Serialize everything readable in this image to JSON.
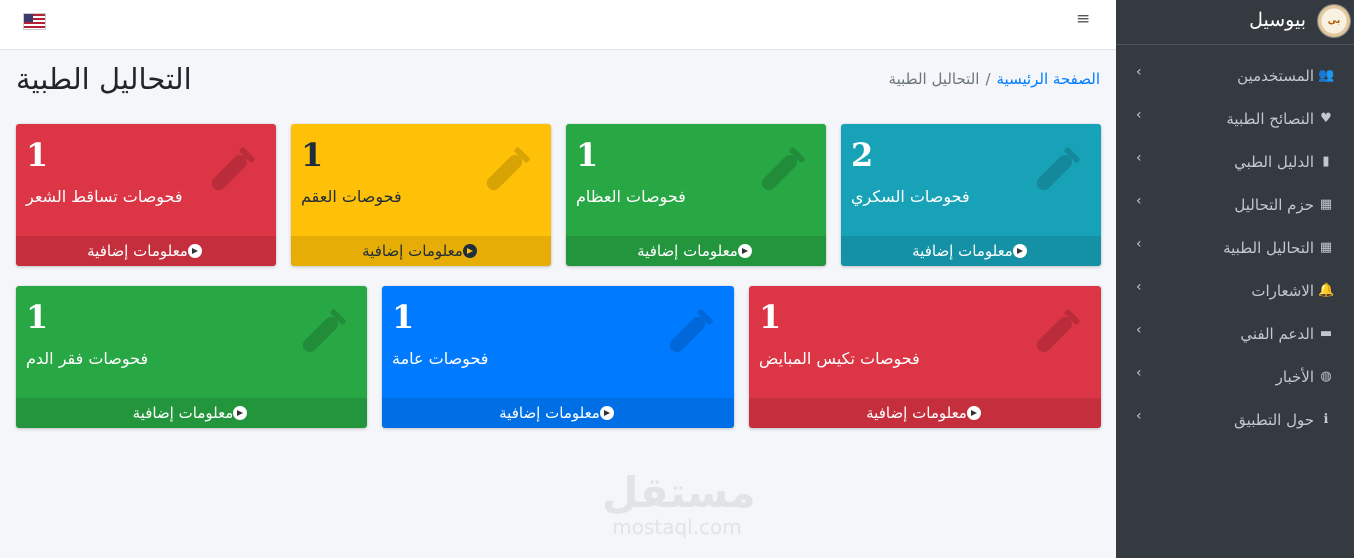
{
  "navbar": {
    "menu_icon": "bars-icon",
    "flag": "us-flag-icon"
  },
  "brand": {
    "name": "بيوسيل",
    "logo_text": "بي"
  },
  "sidebar": {
    "items": [
      {
        "label": "المستخدمين",
        "icon": "users-icon",
        "glyph": "👥"
      },
      {
        "label": "النصائح الطبية",
        "icon": "heartbeat-icon",
        "glyph": "♥"
      },
      {
        "label": "الدليل الطبي",
        "icon": "book-icon",
        "glyph": "▮"
      },
      {
        "label": "حزم التحاليل",
        "icon": "table-icon",
        "glyph": "▦"
      },
      {
        "label": "التحاليل الطبية",
        "icon": "table-icon",
        "glyph": "▦"
      },
      {
        "label": "الاشعارات",
        "icon": "bell-icon",
        "glyph": "🔔"
      },
      {
        "label": "الدعم الفني",
        "icon": "ticket-icon",
        "glyph": "▬"
      },
      {
        "label": "الأخبار",
        "icon": "globe-icon",
        "glyph": "◍"
      },
      {
        "label": "حول التطبيق",
        "icon": "info-icon",
        "glyph": "ℹ"
      }
    ]
  },
  "header": {
    "title": "التحاليل الطبية",
    "breadcrumb": {
      "home": "الصفحة الرئيسية",
      "current": "التحاليل الطبية"
    }
  },
  "boxes": [
    {
      "count": "1",
      "title": "فحوصات تساقط الشعر",
      "link": "معلومات إضافية",
      "color": "#dc3545",
      "icon": "vial-icon"
    },
    {
      "count": "1",
      "title": "فحوصات العقم",
      "link": "معلومات إضافية",
      "color": "#ffc107",
      "icon": "vial-icon"
    },
    {
      "count": "1",
      "title": "فحوصات العظام",
      "link": "معلومات إضافية",
      "color": "#28a745",
      "icon": "vial-icon"
    },
    {
      "count": "2",
      "title": "فحوصات السكري",
      "link": "معلومات إضافية",
      "color": "#17a2b8",
      "icon": "vial-icon"
    },
    {
      "count": "1",
      "title": "فحوصات فقر الدم",
      "link": "معلومات إضافية",
      "color": "#28a745",
      "icon": "vial-icon"
    },
    {
      "count": "1",
      "title": "فحوصات عامة",
      "link": "معلومات إضافية",
      "color": "#007bff",
      "icon": "vial-icon"
    },
    {
      "count": "1",
      "title": "فحوصات تكيس المبايض",
      "link": "معلومات إضافية",
      "color": "#dc3545",
      "icon": "vial-icon"
    }
  ],
  "watermark": {
    "arabic": "مستقل",
    "latin": "mostaql.com"
  }
}
